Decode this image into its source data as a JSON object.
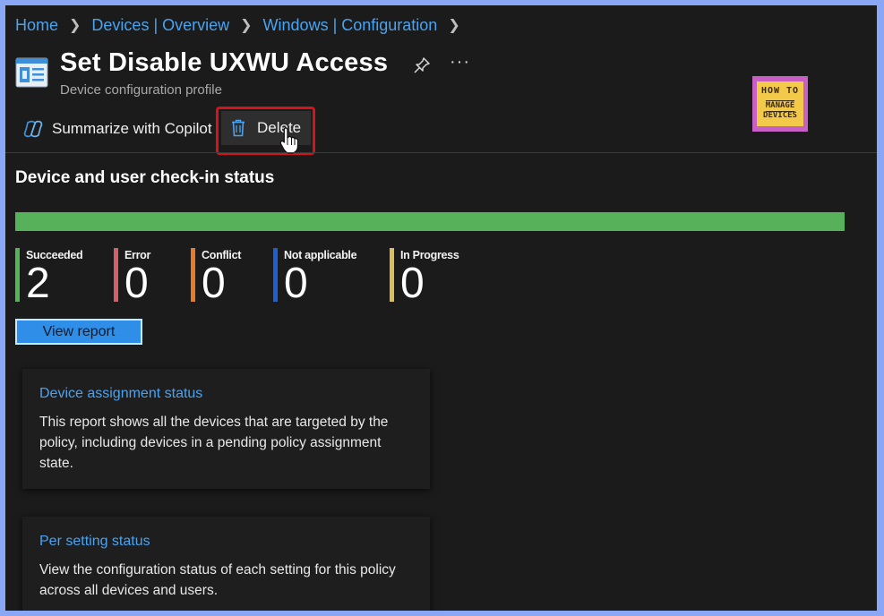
{
  "breadcrumb": [
    "Home",
    "Devices | Overview",
    "Windows | Configuration"
  ],
  "header": {
    "title": "Set Disable UXWU Access",
    "subtitle": "Device configuration profile",
    "more": "···"
  },
  "logo": {
    "line1": "HOW TO",
    "line2": "MANAGE",
    "line3": "DEVICES"
  },
  "toolbar": {
    "copilot_label": "Summarize with Copilot",
    "delete_label": "Delete"
  },
  "status": {
    "title": "Device and user check-in status",
    "progress": 1.0,
    "stats": [
      {
        "label": "Succeeded",
        "value": "2",
        "color": "#56b15a"
      },
      {
        "label": "Error",
        "value": "0",
        "color": "#d35f6b"
      },
      {
        "label": "Conflict",
        "value": "0",
        "color": "#e87a2c"
      },
      {
        "label": "Not applicable",
        "value": "0",
        "color": "#1f5fd6"
      },
      {
        "label": "In Progress",
        "value": "0",
        "color": "#d8c15a"
      }
    ],
    "view_report_label": "View report"
  },
  "cards": [
    {
      "title": "Device assignment status",
      "description": "This report shows all the devices that are targeted by the policy, including devices in a pending policy assignment state."
    },
    {
      "title": "Per setting status",
      "description": "View the configuration status of each setting for this policy across all devices and users."
    }
  ],
  "colors": {
    "link": "#4aa3f0",
    "accent": "#2e8ee8",
    "highlight": "#d4131a",
    "background": "#1b1b1b"
  }
}
